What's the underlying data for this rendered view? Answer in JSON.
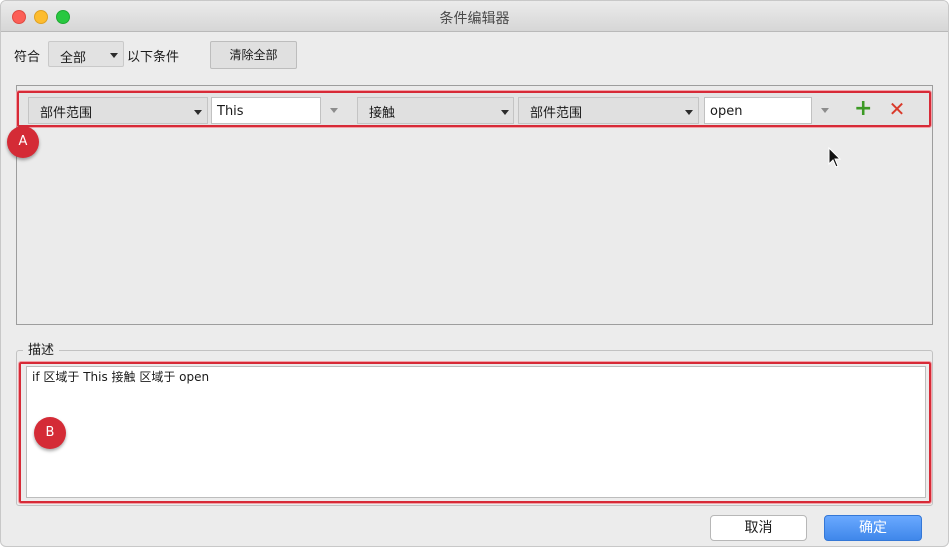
{
  "window": {
    "title": "条件编辑器"
  },
  "match": {
    "prefix": "符合",
    "mode": "全部",
    "suffix": "以下条件",
    "clear_button": "清除全部"
  },
  "condition": {
    "field1": "部件范围",
    "value1": "This",
    "operator": "接触",
    "field2": "部件范围",
    "value2": "open"
  },
  "markers": {
    "a": "A",
    "b": "B"
  },
  "description": {
    "legend": "描述",
    "text": "if 区域于 This 接触 区域于 open"
  },
  "footer": {
    "cancel": "取消",
    "ok": "确定"
  },
  "icons": {
    "add": "plus-icon",
    "delete": "x-icon",
    "dropdown": "chevron-down-icon",
    "pointer": "mouse-pointer-icon"
  },
  "colors": {
    "add": "#3c9a25",
    "delete": "#d93a2b",
    "highlight": "#d72a37",
    "primary_button": "#3f87ea"
  }
}
